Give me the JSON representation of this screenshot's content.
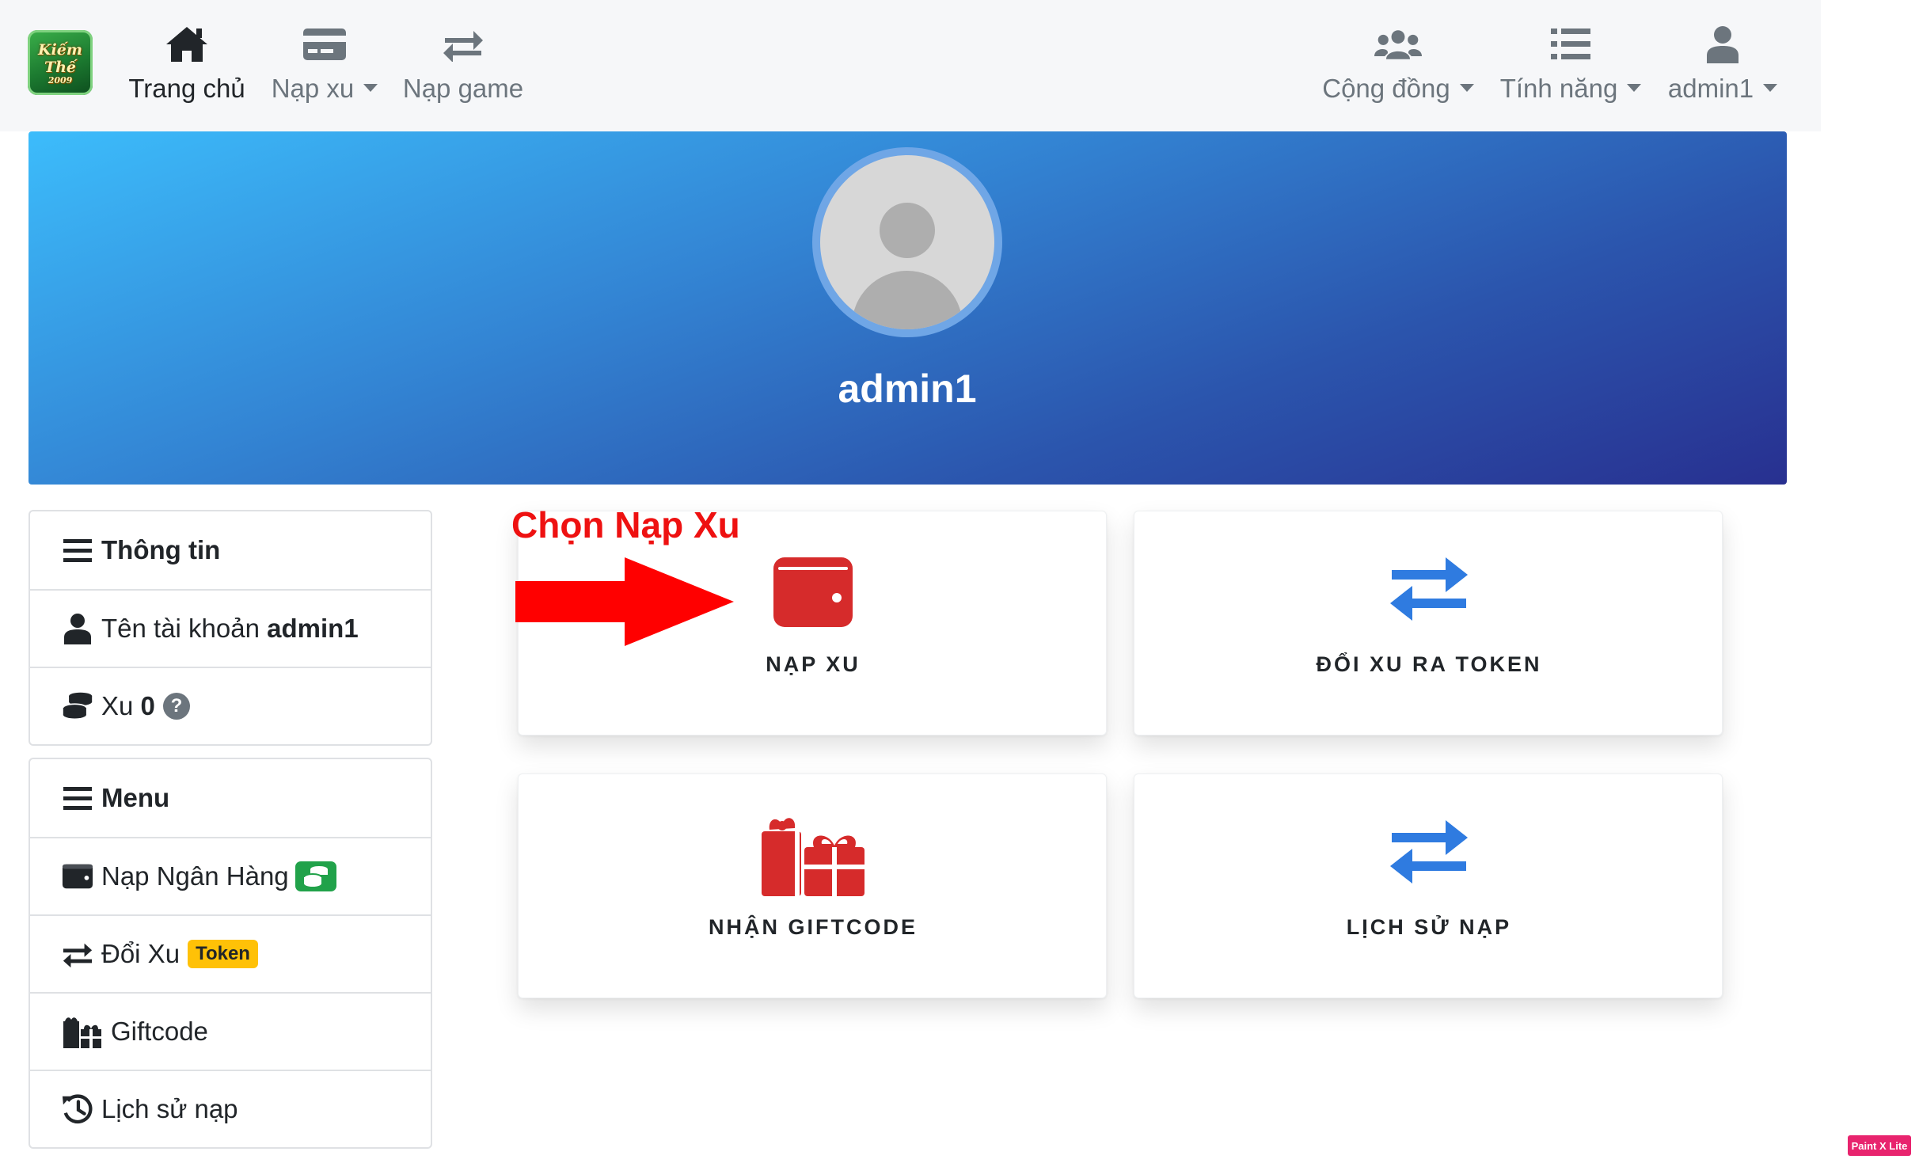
{
  "nav": {
    "home_label": "Trang chủ",
    "nap_xu_label": "Nạp xu",
    "nap_game_label": "Nạp game",
    "community_label": "Cộng đồng",
    "features_label": "Tính năng",
    "user_label": "admin1",
    "icons": [
      "home-icon",
      "credit-card-icon",
      "exchange-icon",
      "users-icon",
      "list-icon",
      "user-icon"
    ]
  },
  "banner": {
    "username": "admin1",
    "gradient": [
      "#3cbcfb",
      "#283090"
    ]
  },
  "info_card": {
    "title": "Thông tin",
    "account_label": "Tên tài khoản",
    "account_value": "admin1",
    "xu_label": "Xu",
    "xu_value": "0",
    "help_glyph": "?"
  },
  "menu_card": {
    "title": "Menu",
    "items": [
      {
        "label": "Nạp Ngân Hàng",
        "icon": "wallet-icon"
      },
      {
        "label": "Đổi Xu",
        "badge": "Token",
        "icon": "exchange-icon"
      },
      {
        "label": "Giftcode",
        "icon": "gifts-icon"
      },
      {
        "label": "Lịch sử nạp",
        "icon": "history-icon"
      }
    ]
  },
  "tiles": {
    "nap_xu": "NẠP XU",
    "doi_xu": "ĐỔI XU RA TOKEN",
    "giftcode": "NHẬN GIFTCODE",
    "lich_su": "LỊCH SỬ NẠP"
  },
  "annotation": {
    "text": "Chọn Nạp Xu",
    "color": "#ee1111"
  },
  "colors": {
    "accent_red": "#d62b2b",
    "accent_blue": "#2f7be0",
    "badge_green": "#21a24a",
    "badge_yellow": "#ffc107"
  },
  "logo": {
    "text_line1": "Kiếm",
    "text_line2": "Thế",
    "text_line3": "2009"
  },
  "watermark": "Paint X Lite"
}
